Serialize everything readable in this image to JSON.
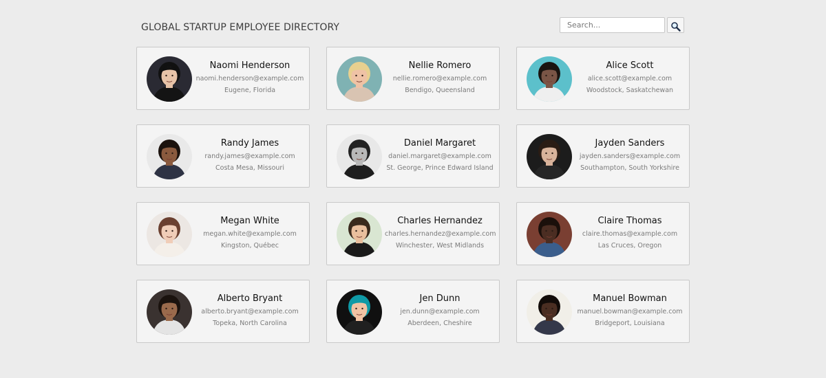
{
  "header": {
    "title": "GLOBAL STARTUP EMPLOYEE DIRECTORY",
    "search_placeholder": "Search...",
    "search_icon": "magnifier-icon"
  },
  "employees": [
    {
      "name": "Naomi Henderson",
      "email": "naomi.henderson@example.com",
      "location": "Eugene, Florida",
      "photo": {
        "bg": "#2a2a33",
        "skin": "#e7c3a8",
        "hair": "#111111",
        "shirt": "#141414"
      }
    },
    {
      "name": "Nellie Romero",
      "email": "nellie.romero@example.com",
      "location": "Bendigo, Queensland",
      "photo": {
        "bg": "#7fb2b3",
        "skin": "#efc2a5",
        "hair": "#e8d08f",
        "shirt": "#d9c4b2"
      }
    },
    {
      "name": "Alice Scott",
      "email": "alice.scott@example.com",
      "location": "Woodstock, Saskatchewan",
      "photo": {
        "bg": "#5cc0cb",
        "skin": "#7a5546",
        "hair": "#1a1410",
        "shirt": "#efefef"
      }
    },
    {
      "name": "Randy James",
      "email": "randy.james@example.com",
      "location": "Costa Mesa, Missouri",
      "photo": {
        "bg": "#e9e9e9",
        "skin": "#8a5a3e",
        "hair": "#1b120d",
        "shirt": "#2e3344"
      }
    },
    {
      "name": "Daniel Margaret",
      "email": "daniel.margaret@example.com",
      "location": "St. George, Prince Edward Island",
      "photo": {
        "bg": "#e8e8e8",
        "skin": "#b8b8b8",
        "hair": "#222222",
        "shirt": "#1e1e1e"
      }
    },
    {
      "name": "Jayden Sanders",
      "email": "jayden.sanders@example.com",
      "location": "Southampton, South Yorkshire",
      "photo": {
        "bg": "#1c1c1c",
        "skin": "#d8b29a",
        "hair": "#2a1c14",
        "shirt": "#262626"
      }
    },
    {
      "name": "Megan White",
      "email": "megan.white@example.com",
      "location": "Kingston, Québec",
      "photo": {
        "bg": "#ece7e3",
        "skin": "#f0cdb8",
        "hair": "#6b4030",
        "shirt": "#f4efe9"
      }
    },
    {
      "name": "Charles Hernandez",
      "email": "charles.hernandez@example.com",
      "location": "Winchester, West Midlands",
      "photo": {
        "bg": "#d9e6d2",
        "skin": "#e9bf9d",
        "hair": "#3a2a1c",
        "shirt": "#1a1a1a"
      }
    },
    {
      "name": "Claire Thomas",
      "email": "claire.thomas@example.com",
      "location": "Las Cruces, Oregon",
      "photo": {
        "bg": "#7a3f32",
        "skin": "#4b2d22",
        "hair": "#1b100b",
        "shirt": "#3b5e8c"
      }
    },
    {
      "name": "Alberto Bryant",
      "email": "alberto.bryant@example.com",
      "location": "Topeka, North Carolina",
      "photo": {
        "bg": "#3a3230",
        "skin": "#9a6a4c",
        "hair": "#1a120e",
        "shirt": "#e4e4e4"
      }
    },
    {
      "name": "Jen Dunn",
      "email": "jen.dunn@example.com",
      "location": "Aberdeen, Cheshire",
      "photo": {
        "bg": "#101010",
        "skin": "#f0c3a4",
        "hair": "#0f9aa6",
        "shirt": "#202020"
      }
    },
    {
      "name": "Manuel Bowman",
      "email": "manuel.bowman@example.com",
      "location": "Bridgeport, Louisiana",
      "photo": {
        "bg": "#f1efe8",
        "skin": "#4a2e22",
        "hair": "#120c09",
        "shirt": "#34384a"
      }
    }
  ]
}
